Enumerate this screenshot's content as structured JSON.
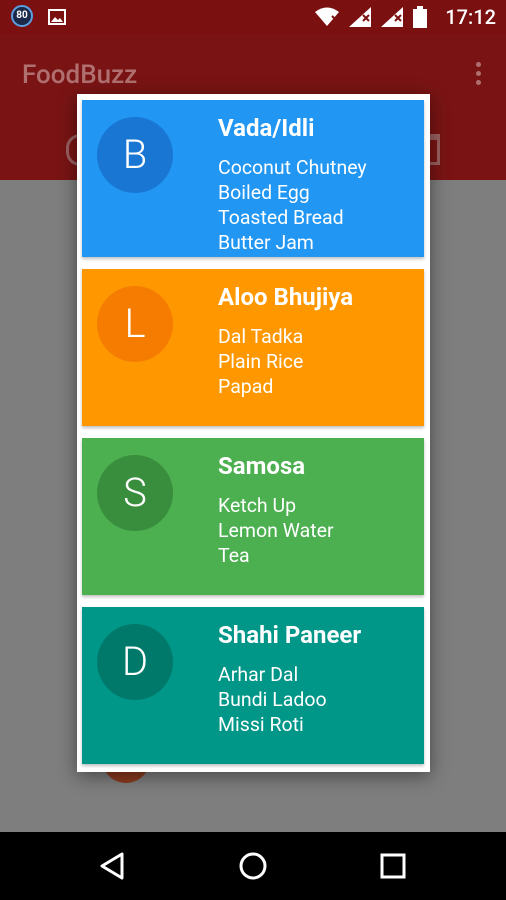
{
  "status_bar": {
    "badge": "80",
    "time": "17:12"
  },
  "app": {
    "title": "FoodBuzz"
  },
  "dialog": {
    "cards": [
      {
        "initial": "B",
        "title": "Vada/Idli",
        "items": [
          "Coconut Chutney",
          "Boiled Egg",
          "Toasted Bread",
          "Butter Jam"
        ],
        "color": "#2196F3",
        "avatar_color": "#1976D2"
      },
      {
        "initial": "L",
        "title": "Aloo Bhujiya",
        "items": [
          "Dal Tadka",
          "Plain Rice",
          "Papad"
        ],
        "color": "#FF9800",
        "avatar_color": "#F57C00"
      },
      {
        "initial": "S",
        "title": "Samosa",
        "items": [
          "Ketch Up",
          "Lemon Water",
          "Tea"
        ],
        "color": "#4CAF50",
        "avatar_color": "#388E3C"
      },
      {
        "initial": "D",
        "title": "Shahi Paneer",
        "items": [
          "Arhar Dal",
          "Bundi Ladoo",
          "Missi Roti"
        ],
        "color": "#009688",
        "avatar_color": "#00796B"
      }
    ]
  },
  "nav_bar": {
    "back_icon": "back-triangle-icon",
    "home_icon": "home-circle-icon",
    "recents_icon": "recents-square-icon"
  }
}
